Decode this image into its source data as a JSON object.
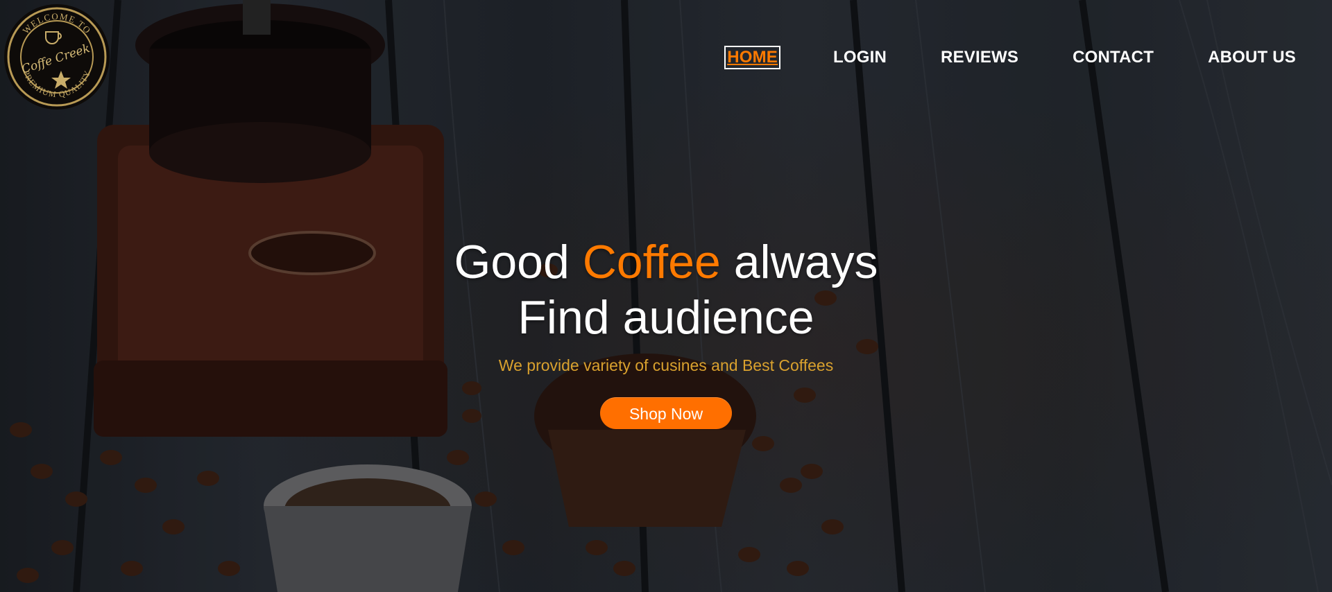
{
  "brand": {
    "logo_text_top": "WELCOME TO",
    "logo_text_middle": "Coffe Creek",
    "logo_text_bottom": "PREMIUM QUALITY"
  },
  "nav": {
    "items": [
      {
        "label": "HOME",
        "active": true
      },
      {
        "label": "LOGIN",
        "active": false
      },
      {
        "label": "REVIEWS",
        "active": false
      },
      {
        "label": "CONTACT",
        "active": false
      },
      {
        "label": "ABOUT US",
        "active": false
      }
    ]
  },
  "hero": {
    "headline_part1": "Good ",
    "headline_accent": "Coffee",
    "headline_part2": " always",
    "headline_line2": "Find audience",
    "subtitle": "We provide variety of cusines and Best Coffees",
    "cta_label": "Shop Now"
  },
  "colors": {
    "accent": "#ff7a00",
    "button": "#ff6f00",
    "subtitle": "#d9a12e",
    "nav_text": "#ffffff"
  },
  "icons": [
    "coffee-cup-icon",
    "star-icon"
  ]
}
